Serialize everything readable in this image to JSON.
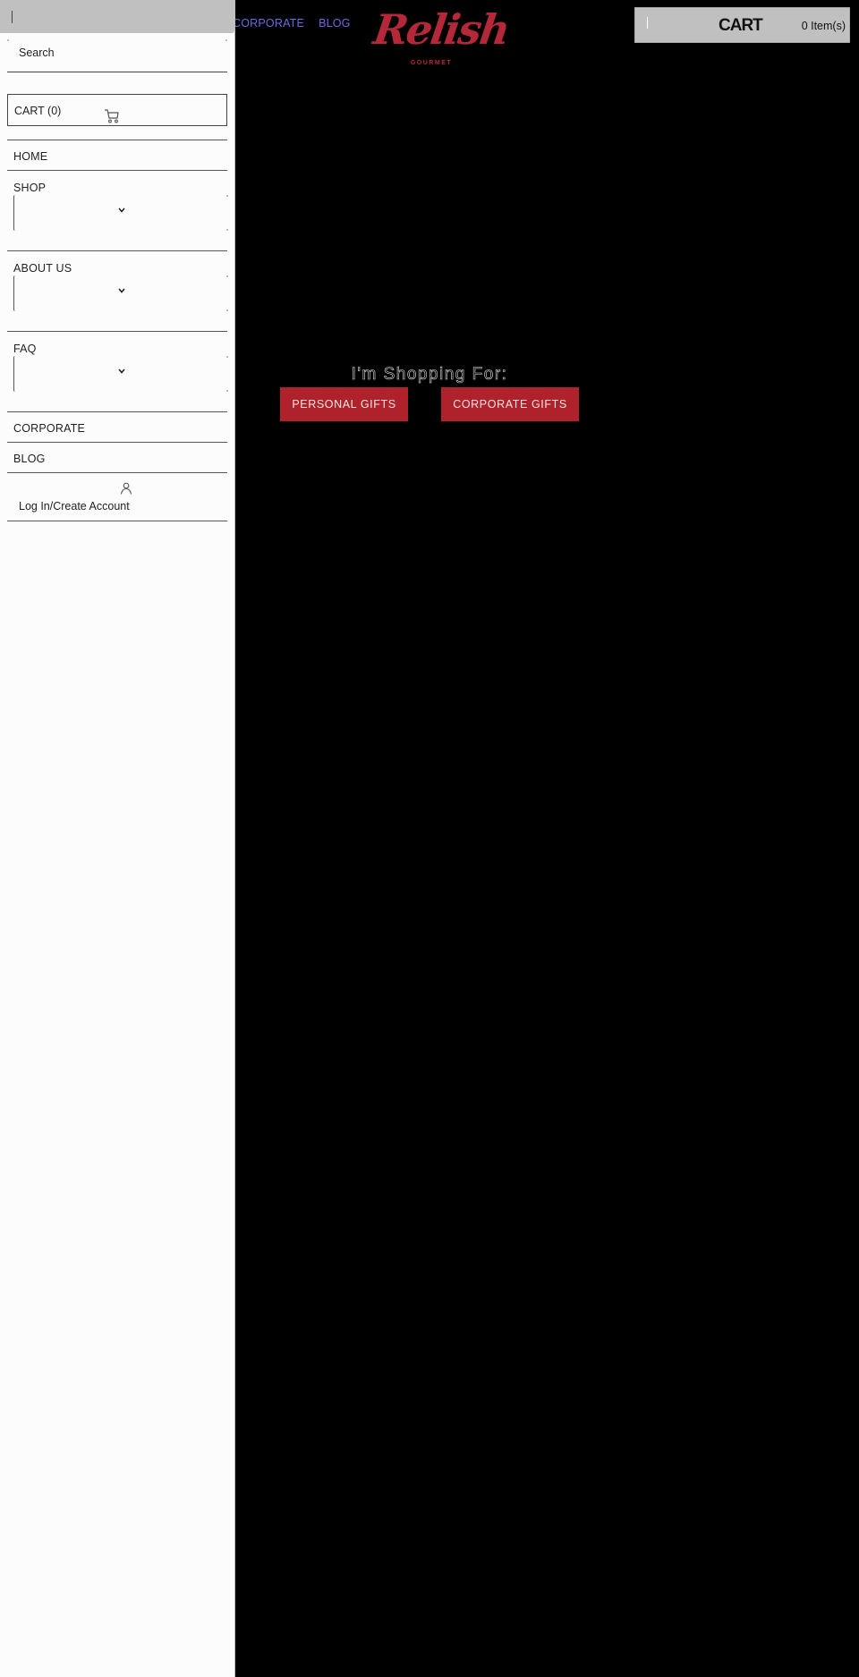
{
  "top_nav": {
    "items": [
      {
        "label": "CORPORATE",
        "icon": null
      },
      {
        "label": "BLOG",
        "icon": null
      }
    ]
  },
  "brand": {
    "name": "Relish",
    "tagline": "GOURMET",
    "color": "#b5283a"
  },
  "header_cart": {
    "label": "CART",
    "count_text": "0 Item(s)"
  },
  "hero": {
    "heading": "I'm Shopping For:",
    "buttons": [
      {
        "label": "PERSONAL GIFTS"
      },
      {
        "label": "CORPORATE GIFTS"
      }
    ],
    "button_color": "#b0222b"
  },
  "drawer": {
    "search": {
      "placeholder": "Search",
      "value": ""
    },
    "cart": {
      "label": "CART (0)",
      "icon": "shopping-cart-icon"
    },
    "nav": [
      {
        "label": "HOME",
        "type": "link"
      },
      {
        "label": "SHOP",
        "type": "dropdown",
        "selected": "",
        "icon": "chevron-down-icon"
      },
      {
        "label": "ABOUT US",
        "type": "dropdown",
        "selected": "",
        "icon": "chevron-down-icon"
      },
      {
        "label": "FAQ",
        "type": "dropdown",
        "selected": "",
        "icon": "chevron-down-icon"
      },
      {
        "label": "CORPORATE",
        "type": "link"
      },
      {
        "label": "BLOG",
        "type": "link"
      }
    ],
    "account": {
      "label": "Log In/Create Account",
      "icon": "user-icon"
    }
  }
}
